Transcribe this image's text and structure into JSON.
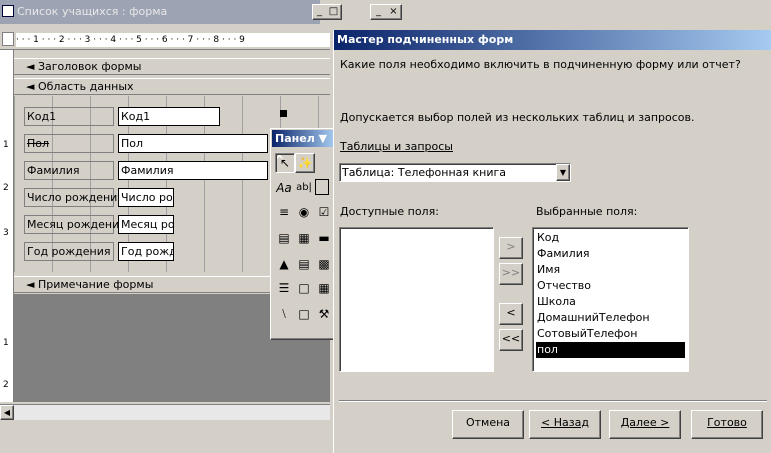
{
  "form_window": {
    "title": "Список учащихся : форма",
    "ruler": "· · · 1 · · · 2 · · · 3 · · · 4 · · · 5 · · · 6 · · · 7 · · · 8 · · · 9",
    "sections": {
      "header": "Заголовок формы",
      "detail": "Область данных",
      "footer": "Примечание формы"
    },
    "fields": [
      {
        "label": "Код1",
        "control": "Код1"
      },
      {
        "label": "Пол",
        "control": "Пол"
      },
      {
        "label": "Фамилия",
        "control": "Фамилия"
      },
      {
        "label": "Число рождения",
        "control": "Число рож"
      },
      {
        "label": "Месяц рождения",
        "control": "Месяц рож"
      },
      {
        "label": "Год рождения",
        "control": "Год рождеı"
      }
    ],
    "vruler": [
      "1",
      "2",
      "3",
      "1",
      "2"
    ]
  },
  "toolbox": {
    "title": "Панел ▼ ×",
    "text_tools": [
      "Aa",
      "ab|"
    ]
  },
  "wizard": {
    "title": "Мастер подчиненных форм",
    "question": "Какие поля необходимо включить в подчиненную форму или отчет?",
    "hint": "Допускается выбор полей из нескольких таблиц и запросов.",
    "tables_label": "Таблицы и запросы",
    "table_select": "Таблица: Телефонная книга",
    "available_label": "Доступные поля:",
    "selected_label": "Выбранные поля:",
    "selected_fields": [
      "Код",
      "Фамилия",
      "Имя",
      "Отчество",
      "Школа",
      "ДомашнийТелефон",
      "СотовыйТелефон",
      "пол"
    ],
    "move_buttons": [
      ">",
      ">>",
      "<",
      "<<"
    ],
    "buttons": {
      "cancel": "Отмена",
      "back": "< Назад",
      "next": "Далее >",
      "finish": "Готово"
    }
  },
  "window_buttons": {
    "minimize": "_",
    "maximize": "□",
    "close": "×"
  },
  "colors": {
    "active_title": "#0a246a",
    "face": "#d4d0c8",
    "selection": "#000000"
  }
}
